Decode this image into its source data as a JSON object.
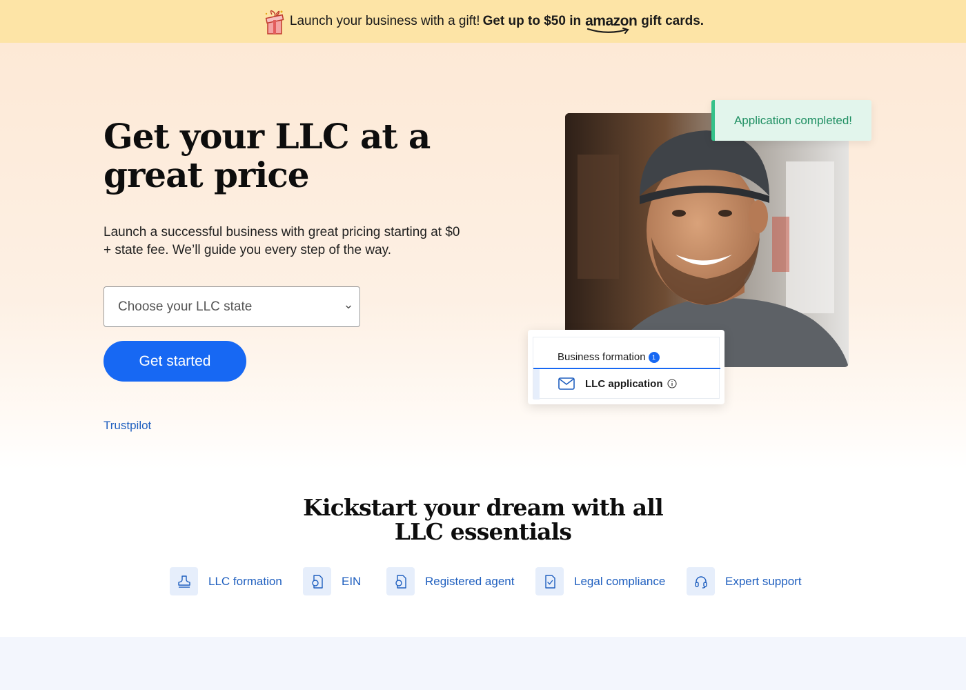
{
  "promo": {
    "lead": "Launch your business with a gift!",
    "bold": "Get up to $50 in",
    "brand": "amazon",
    "tail": "gift cards."
  },
  "hero": {
    "title": "Get your LLC at a great price",
    "subtitle": "Launch a successful business with great pricing starting at $0 + state fee. We’ll guide you every step of the way.",
    "state_select": {
      "value": "Choose your LLC state"
    },
    "cta_label": "Get started",
    "trustpilot_label": "Trustpilot"
  },
  "illustration": {
    "toast": "Application completed!",
    "section_label": "Business formation",
    "section_badge": "1",
    "task_label": "LLC application"
  },
  "essentials": {
    "title": "Kickstart your dream with all LLC essentials",
    "items": [
      {
        "label": "LLC formation",
        "icon": "stamp-icon"
      },
      {
        "label": "EIN",
        "icon": "document-seal-icon"
      },
      {
        "label": "Registered agent",
        "icon": "document-seal-icon"
      },
      {
        "label": "Legal compliance",
        "icon": "document-check-icon"
      },
      {
        "label": "Expert support",
        "icon": "headset-icon"
      }
    ]
  },
  "colors": {
    "promo_bg": "#fde4a6",
    "hero_bg": "#fde9d6",
    "primary": "#1768f3",
    "link": "#1f5fbf",
    "success": "#34c28a"
  }
}
